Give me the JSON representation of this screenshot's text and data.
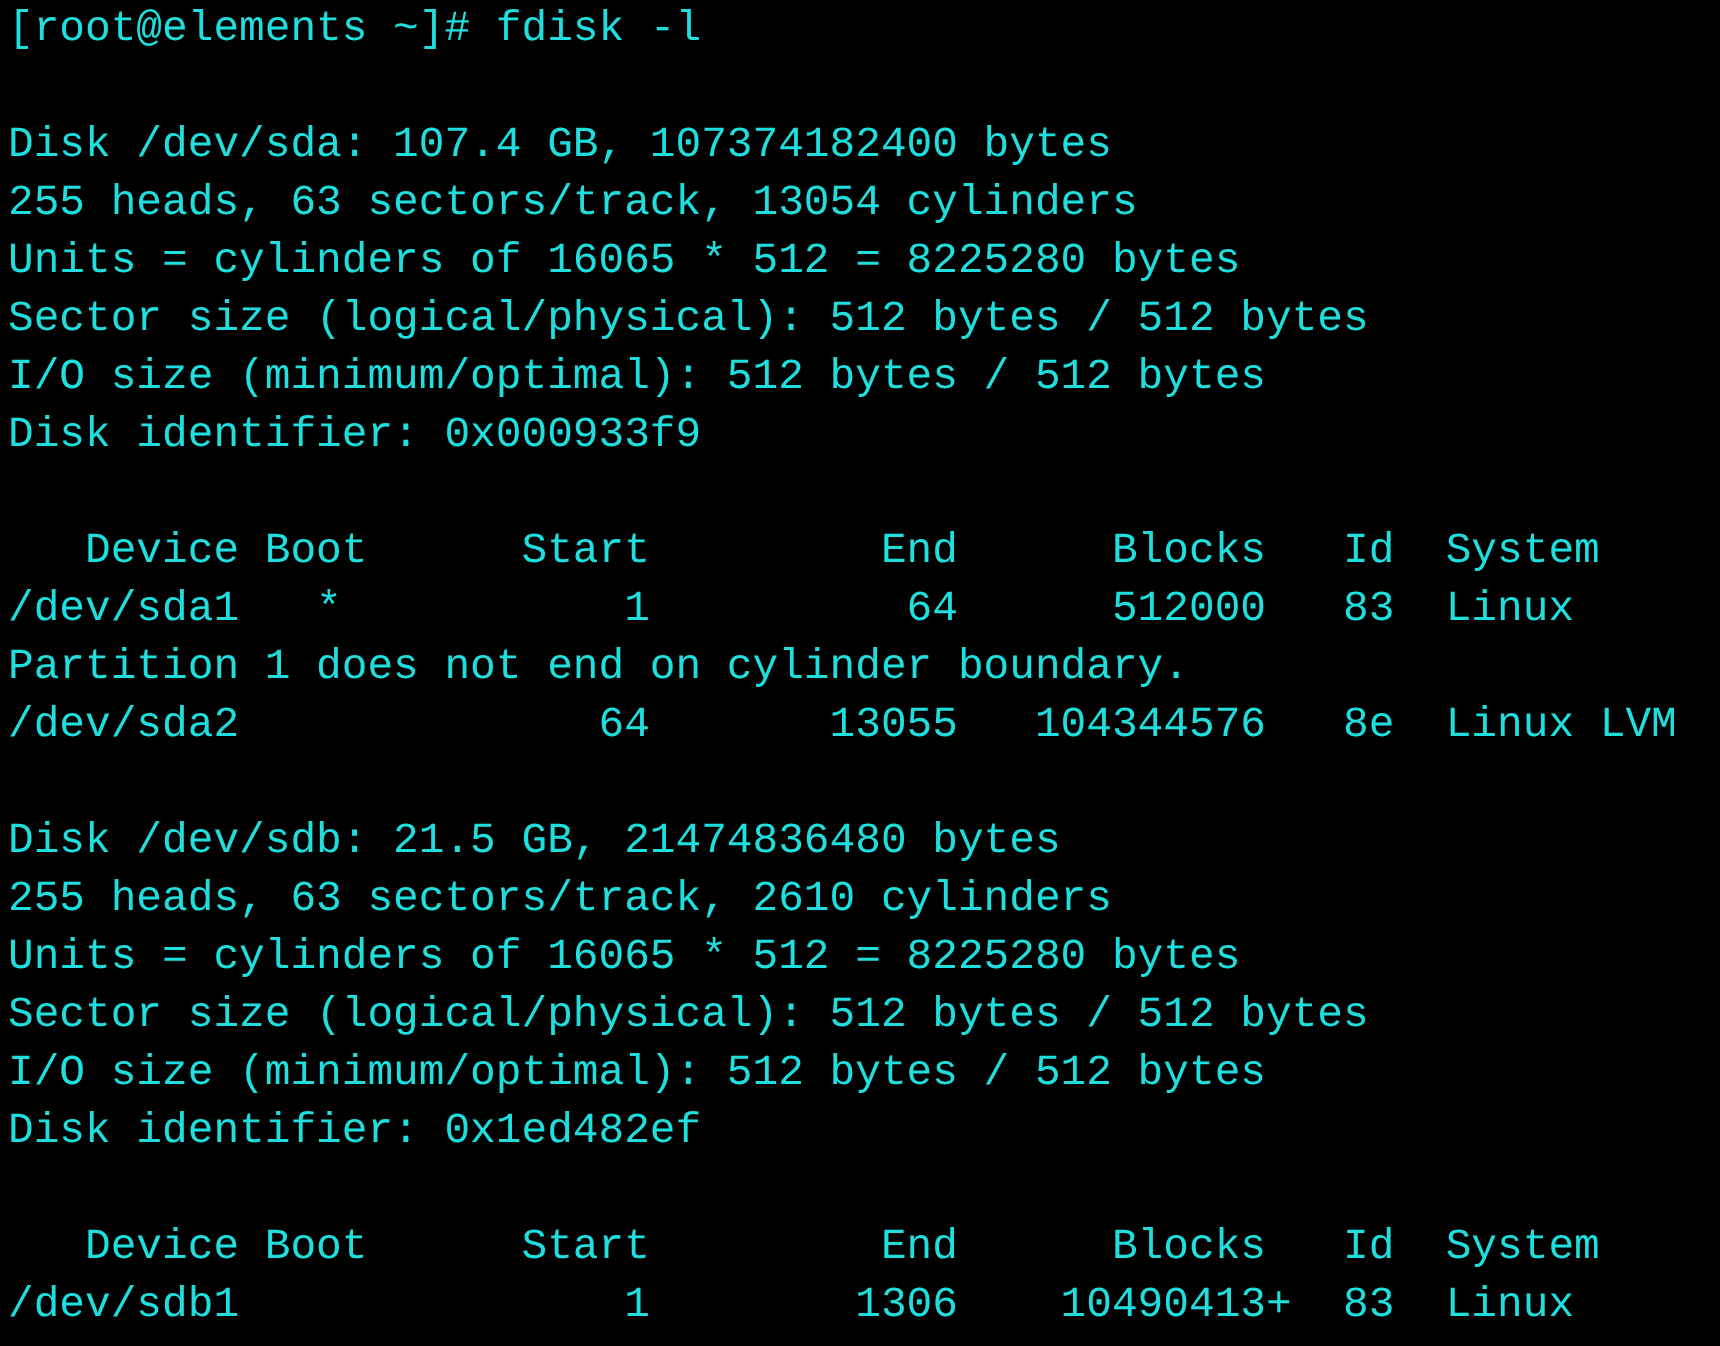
{
  "terminal": {
    "blocks": [
      {
        "lines": [
          "[root@elements ~]# fdisk -l"
        ]
      },
      {
        "lines": [
          "Disk /dev/sda: 107.4 GB, 107374182400 bytes",
          "255 heads, 63 sectors/track, 13054 cylinders",
          "Units = cylinders of 16065 * 512 = 8225280 bytes",
          "Sector size (logical/physical): 512 bytes / 512 bytes",
          "I/O size (minimum/optimal): 512 bytes / 512 bytes",
          "Disk identifier: 0x000933f9"
        ]
      },
      {
        "lines": [
          "   Device Boot      Start         End      Blocks   Id  System",
          "/dev/sda1   *           1          64      512000   83  Linux",
          "Partition 1 does not end on cylinder boundary.",
          "/dev/sda2              64       13055   104344576   8e  Linux LVM"
        ]
      },
      {
        "lines": [
          "Disk /dev/sdb: 21.5 GB, 21474836480 bytes",
          "255 heads, 63 sectors/track, 2610 cylinders",
          "Units = cylinders of 16065 * 512 = 8225280 bytes",
          "Sector size (logical/physical): 512 bytes / 512 bytes",
          "I/O size (minimum/optimal): 512 bytes / 512 bytes",
          "Disk identifier: 0x1ed482ef"
        ]
      },
      {
        "lines": [
          "   Device Boot      Start         End      Blocks   Id  System",
          "/dev/sdb1               1        1306    10490413+  83  Linux"
        ]
      }
    ]
  }
}
